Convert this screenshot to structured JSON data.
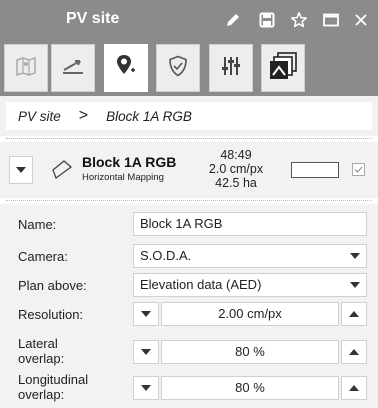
{
  "window": {
    "title": "PV site"
  },
  "titlebar_icons": [
    "pencil-icon",
    "save-icon",
    "star-icon",
    "window-icon",
    "close-icon"
  ],
  "toolbar": {
    "tools": [
      "map-icon",
      "takeoff-icon",
      "waypoint-icon",
      "shield-check-icon",
      "sliders-icon",
      "layers-icon"
    ],
    "active_tool": "waypoint-icon"
  },
  "breadcrumb": {
    "root": "PV site",
    "separator": ">",
    "current": "Block 1A RGB"
  },
  "block": {
    "name": "Block 1A RGB",
    "subtitle": "Horizontal Mapping",
    "duration": "48:49",
    "gsd": "2.0 cm/px",
    "area": "42.5 ha",
    "checked": true
  },
  "form": {
    "name": {
      "label": "Name:",
      "value": "Block 1A RGB"
    },
    "camera": {
      "label": "Camera:",
      "value": "S.O.D.A."
    },
    "plan_above": {
      "label": "Plan above:",
      "value": "Elevation data (AED)"
    },
    "resolution": {
      "label": "Resolution:",
      "value": "2.00 cm/px"
    },
    "lateral_overlap": {
      "label_line1": "Lateral",
      "label_line2": "overlap:",
      "value": "80 %"
    },
    "longitudinal_overlap": {
      "label_line1": "Longitudinal",
      "label_line2": "overlap:",
      "value": "80 %"
    }
  },
  "colors": {
    "header_bg": "#8b8b8b",
    "panel_bg": "#f2f2f2",
    "active_tool_bg": "#ffffff"
  }
}
